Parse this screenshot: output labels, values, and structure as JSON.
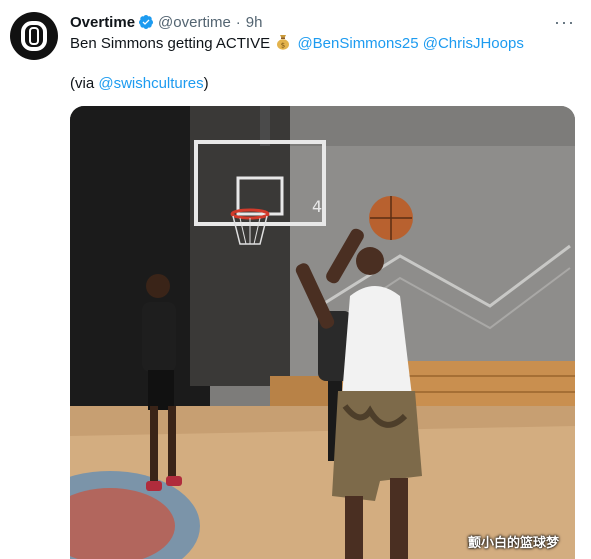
{
  "tweet": {
    "author_name": "Overtime",
    "handle": "@overtime",
    "separator": "·",
    "time": "9h",
    "more_label": "···",
    "text_main": "Ben Simmons getting ACTIVE",
    "mention_1": "@BenSimmons25",
    "mention_2": "@ChrisJHoops",
    "via_open": "(via ",
    "via_mention": "@swishcultures",
    "via_close": ")"
  },
  "media": {
    "backboard_number": "4",
    "watermark": "颤小白的篮球梦"
  },
  "colors": {
    "link": "#1d9bf0",
    "verified": "#1d9bf0",
    "secondary_text": "#536471"
  }
}
